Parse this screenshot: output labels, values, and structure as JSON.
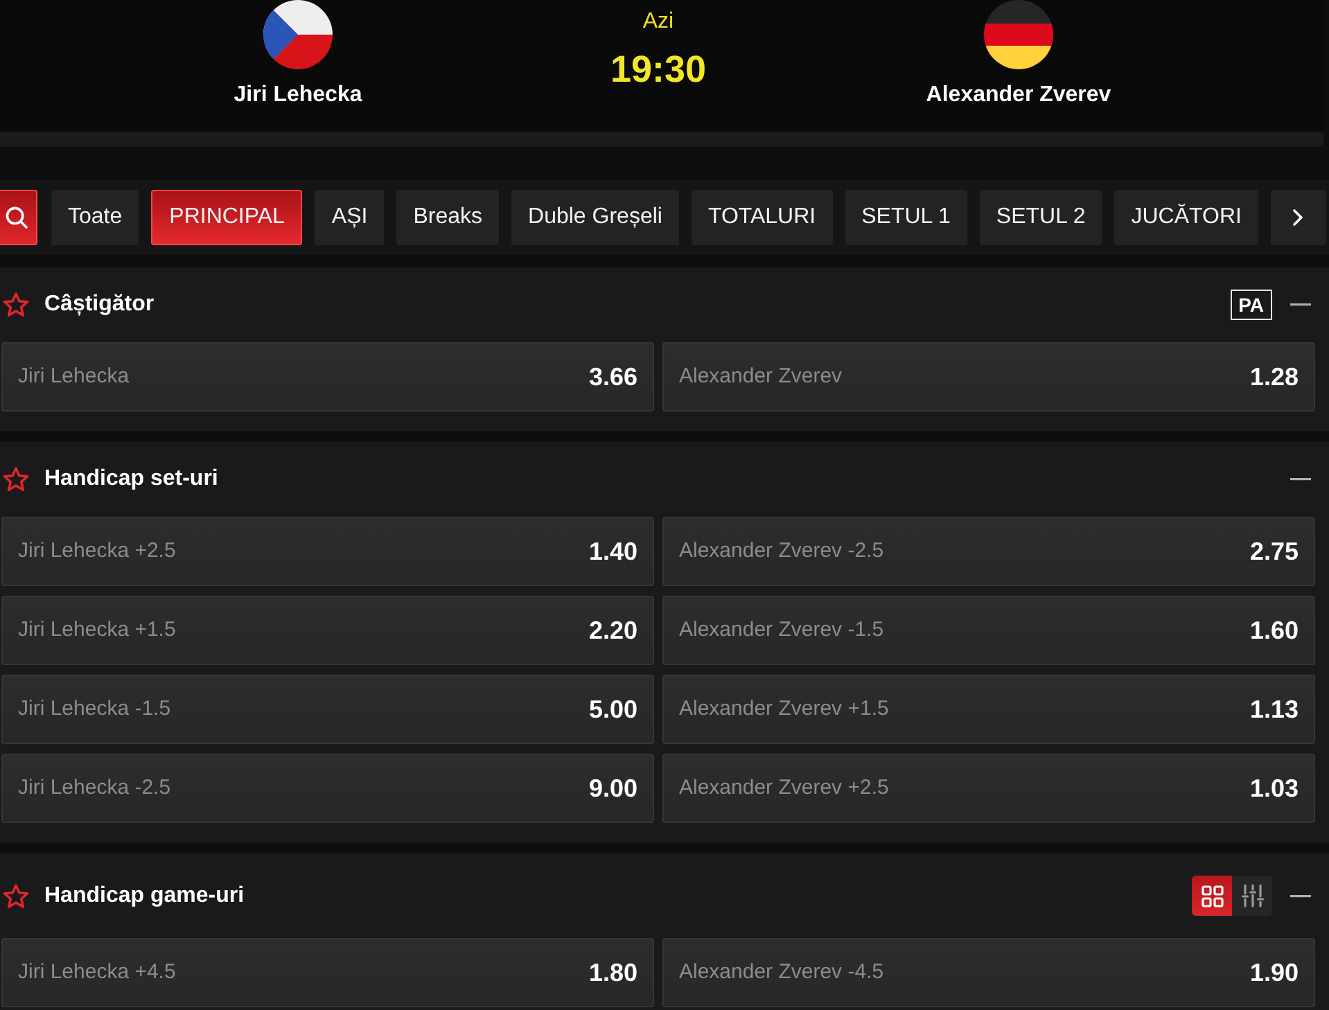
{
  "match": {
    "home": {
      "name": "Jiri Lehecka"
    },
    "day": "Azi",
    "time": "19:30",
    "away": {
      "name": "Alexander Zverev"
    }
  },
  "tabs": [
    {
      "label": "Toate",
      "selected": false
    },
    {
      "label": "PRINCIPAL",
      "selected": true
    },
    {
      "label": "AȘI",
      "selected": false
    },
    {
      "label": "Breaks",
      "selected": false
    },
    {
      "label": "Duble Greșeli",
      "selected": false
    },
    {
      "label": "TOTALURI",
      "selected": false
    },
    {
      "label": "SETUL 1",
      "selected": false
    },
    {
      "label": "SETUL 2",
      "selected": false
    },
    {
      "label": "JUCĂTORI",
      "selected": false
    }
  ],
  "markets": [
    {
      "title": "Câștigător",
      "favorite": false,
      "badge": "PA",
      "expanded": true,
      "rows": [
        [
          {
            "label": "Jiri Lehecka",
            "odds": "3.66"
          },
          {
            "label": "Alexander Zverev",
            "odds": "1.28"
          }
        ]
      ]
    },
    {
      "title": "Handicap set-uri",
      "favorite": false,
      "expanded": true,
      "rows": [
        [
          {
            "label": "Jiri Lehecka +2.5",
            "odds": "1.40"
          },
          {
            "label": "Alexander Zverev -2.5",
            "odds": "2.75"
          }
        ],
        [
          {
            "label": "Jiri Lehecka +1.5",
            "odds": "2.20"
          },
          {
            "label": "Alexander Zverev -1.5",
            "odds": "1.60"
          }
        ],
        [
          {
            "label": "Jiri Lehecka -1.5",
            "odds": "5.00"
          },
          {
            "label": "Alexander Zverev +1.5",
            "odds": "1.13"
          }
        ],
        [
          {
            "label": "Jiri Lehecka -2.5",
            "odds": "9.00"
          },
          {
            "label": "Alexander Zverev +2.5",
            "odds": "1.03"
          }
        ]
      ]
    },
    {
      "title": "Handicap game-uri",
      "favorite": false,
      "expanded": true,
      "view_modes": [
        {
          "kind": "grid",
          "selected": true
        },
        {
          "kind": "sliders",
          "selected": false
        }
      ],
      "rows": [
        [
          {
            "label": "Jiri Lehecka +4.5",
            "odds": "1.80"
          },
          {
            "label": "Alexander Zverev -4.5",
            "odds": "1.90"
          }
        ]
      ]
    }
  ]
}
